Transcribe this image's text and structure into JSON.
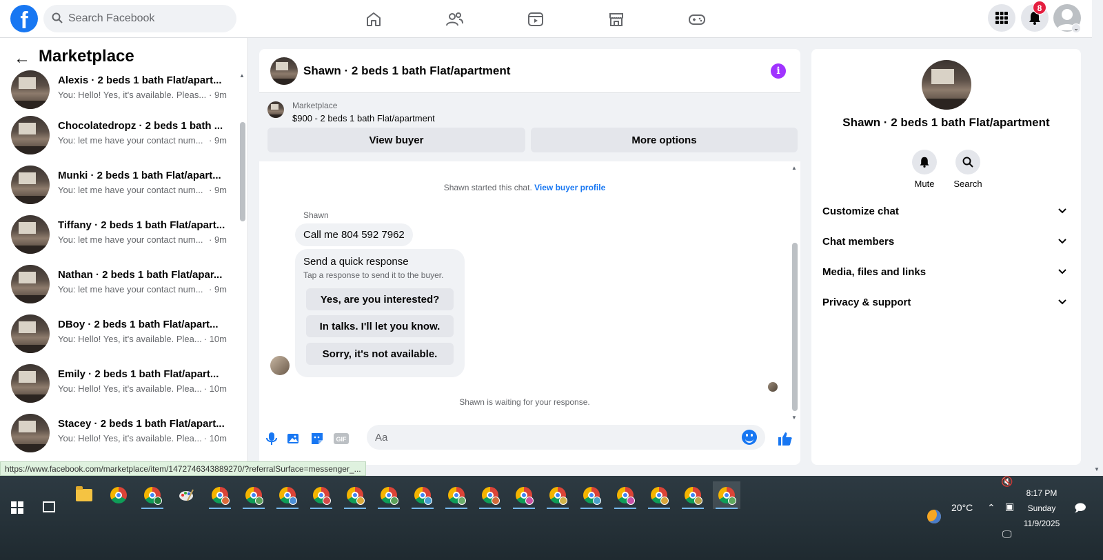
{
  "topbar": {
    "logo": "f",
    "search_placeholder": "Search Facebook",
    "notification_count": "8"
  },
  "sidebar": {
    "back_icon": "arrow-left-icon",
    "title": "Marketplace",
    "conversations": [
      {
        "name": "Alexis · 2 beds 1 bath Flat/apart...",
        "preview": "You: Hello! Yes, it's available. Pleas...",
        "time": "· 9m"
      },
      {
        "name": "Chocolatedropz · 2 beds 1 bath ...",
        "preview": "You: let me have your contact num...",
        "time": "· 9m"
      },
      {
        "name": "Munki · 2 beds 1 bath Flat/apart...",
        "preview": "You: let me have your contact num...",
        "time": "· 9m"
      },
      {
        "name": "Tiffany · 2 beds 1 bath Flat/apart...",
        "preview": "You: let me have your contact num...",
        "time": "· 9m"
      },
      {
        "name": "Nathan · 2 beds 1 bath Flat/apar...",
        "preview": "You: let me have your contact num...",
        "time": "· 9m"
      },
      {
        "name": "DBoy · 2 beds 1 bath Flat/apart...",
        "preview": "You: Hello! Yes, it's available. Plea...",
        "time": "· 10m"
      },
      {
        "name": "Emily · 2 beds 1 bath Flat/apart...",
        "preview": "You: Hello! Yes, it's available. Plea...",
        "time": "· 10m"
      },
      {
        "name": "Stacey · 2 beds 1 bath Flat/apart...",
        "preview": "You: Hello! Yes, it's available. Plea...",
        "time": "· 10m"
      }
    ]
  },
  "chat": {
    "title": "Shawn · 2 beds 1 bath Flat/apartment",
    "marketplace_label": "Marketplace",
    "listing": "$900 - 2 beds 1 bath Flat/apartment",
    "view_buyer": "View buyer",
    "more_options": "More options",
    "started_text": "Shawn started this chat.",
    "view_buyer_profile": "View buyer profile",
    "sender": "Shawn",
    "message": "Call me 804 592 7962",
    "quick_title": "Send a quick response",
    "quick_sub": "Tap a response to send it to the buyer.",
    "quick_replies": [
      "Yes, are you interested?",
      "In talks. I'll let you know.",
      "Sorry, it's not available."
    ],
    "waiting_text": "Shawn is waiting for your response.",
    "input_placeholder": "Aa"
  },
  "info_panel": {
    "title": "Shawn · 2 beds 1 bath Flat/apartment",
    "mute_label": "Mute",
    "search_label": "Search",
    "sections": [
      "Customize chat",
      "Chat members",
      "Media, files and links",
      "Privacy & support"
    ]
  },
  "status_url": "https://www.facebook.com/marketplace/item/1472746343889270/?referralSurface=messenger_...",
  "taskbar": {
    "temperature": "20°C",
    "time": "8:17 PM",
    "day": "Sunday",
    "date": "11/9/2025"
  },
  "colors": {
    "brand": "#1877f2",
    "info_purple": "#a033ff",
    "badge_red": "#e41e3f"
  }
}
